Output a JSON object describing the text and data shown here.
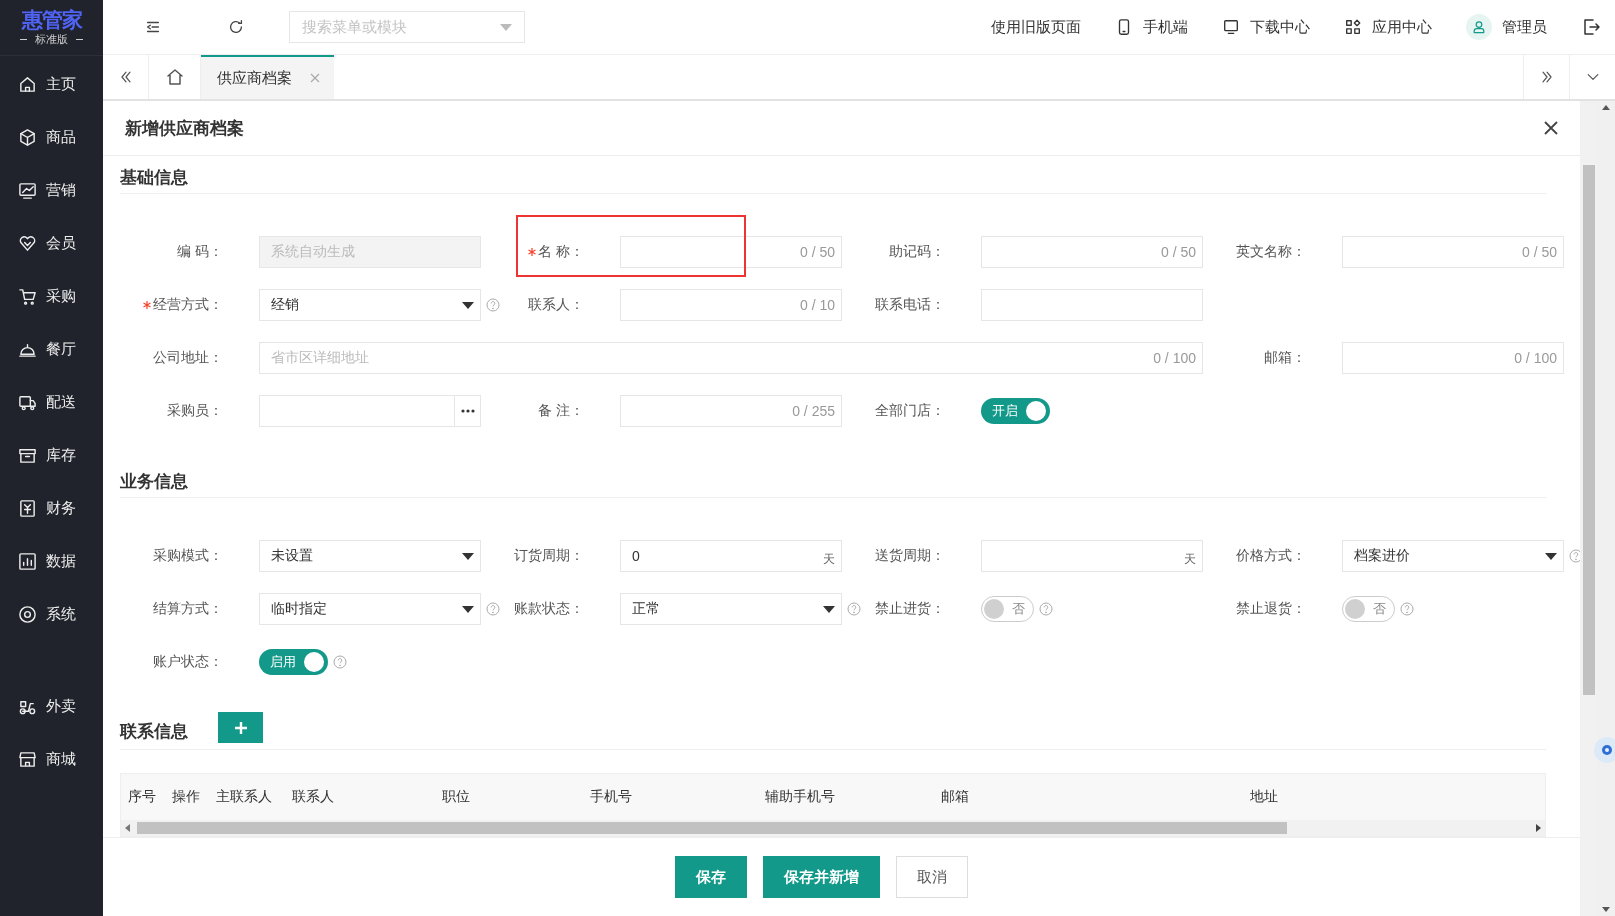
{
  "logo": {
    "title": "惠管家",
    "subtitle": "标准版"
  },
  "sidebar": {
    "groups": [
      [
        {
          "label": "主页"
        },
        {
          "label": "商品"
        },
        {
          "label": "营销"
        },
        {
          "label": "会员"
        },
        {
          "label": "采购"
        },
        {
          "label": "餐厅"
        },
        {
          "label": "配送"
        },
        {
          "label": "库存"
        },
        {
          "label": "财务"
        },
        {
          "label": "数据"
        },
        {
          "label": "系统"
        }
      ],
      [
        {
          "label": "外卖"
        },
        {
          "label": "商城"
        }
      ]
    ]
  },
  "header": {
    "search": {
      "placeholder": "搜索菜单或模块"
    },
    "old_page_link": "使用旧版页面",
    "links": [
      {
        "label": "手机端"
      },
      {
        "label": "下载中心"
      },
      {
        "label": "应用中心"
      }
    ],
    "user": "管理员"
  },
  "tabs": [
    {
      "label": "供应商档案",
      "selected": true
    }
  ],
  "dialog": {
    "title": "新增供应商档案",
    "sections": [
      {
        "title": "基础信息",
        "rows": [
          [
            {
              "label": "编 码：",
              "kind": "text",
              "disabled": true,
              "placeholder": "系统自动生成"
            },
            {
              "label": "名 称：",
              "kind": "text",
              "required": true,
              "highlighted": true,
              "counter": "0 / 50"
            },
            {
              "label": "助记码：",
              "kind": "text",
              "counter": "0 / 50"
            },
            {
              "label": "英文名称：",
              "kind": "text",
              "counter": "0 / 50"
            }
          ],
          [
            {
              "label": "经营方式：",
              "kind": "select",
              "required": true,
              "value": "经销",
              "help": true
            },
            {
              "label": "联系人：",
              "kind": "text",
              "counter": "0 / 10"
            },
            {
              "label": "联系电话：",
              "kind": "text"
            }
          ],
          [
            {
              "label": "公司地址：",
              "kind": "address",
              "placeholder": "省市区详细地址",
              "counter": "0 / 100"
            },
            "",
            "",
            {
              "label": "邮箱：",
              "kind": "text",
              "counter": "0 / 100"
            }
          ],
          [
            {
              "label": "采购员：",
              "kind": "lookup"
            },
            {
              "label": "备 注：",
              "kind": "text",
              "counter": "0 / 255"
            },
            {
              "label": "全部门店：",
              "kind": "switch",
              "on": true,
              "text": "开启"
            }
          ]
        ]
      },
      {
        "title": "业务信息",
        "rows": [
          [
            {
              "label": "采购模式：",
              "kind": "select",
              "value": "未设置"
            },
            {
              "label": "订货周期：",
              "kind": "text",
              "value": "0",
              "suffix": "天"
            },
            {
              "label": "送货周期：",
              "kind": "text",
              "suffix": "天"
            },
            {
              "label": "价格方式：",
              "kind": "select",
              "value": "档案进价",
              "help": true
            }
          ],
          [
            {
              "label": "结算方式：",
              "kind": "select",
              "value": "临时指定",
              "help": true
            },
            {
              "label": "账款状态：",
              "kind": "select",
              "value": "正常",
              "help": true
            },
            {
              "label": "禁止进货：",
              "kind": "switch",
              "on": false,
              "text": "否",
              "help": true
            },
            {
              "label": "禁止退货：",
              "kind": "switch",
              "on": false,
              "text": "否",
              "help": true
            }
          ],
          [
            {
              "label": "账户状态：",
              "kind": "switch",
              "on": true,
              "text": "启用",
              "help": true
            }
          ]
        ]
      }
    ],
    "contacts": {
      "title": "联系信息",
      "columns": [
        "序号",
        "操作",
        "主联系人",
        "联系人",
        "职位",
        "手机号",
        "辅助手机号",
        "邮箱",
        "地址"
      ]
    },
    "buttons": [
      {
        "label": "保存",
        "kind": "primary"
      },
      {
        "label": "保存并新增",
        "kind": "primary"
      },
      {
        "label": "取消",
        "kind": "default"
      }
    ]
  }
}
